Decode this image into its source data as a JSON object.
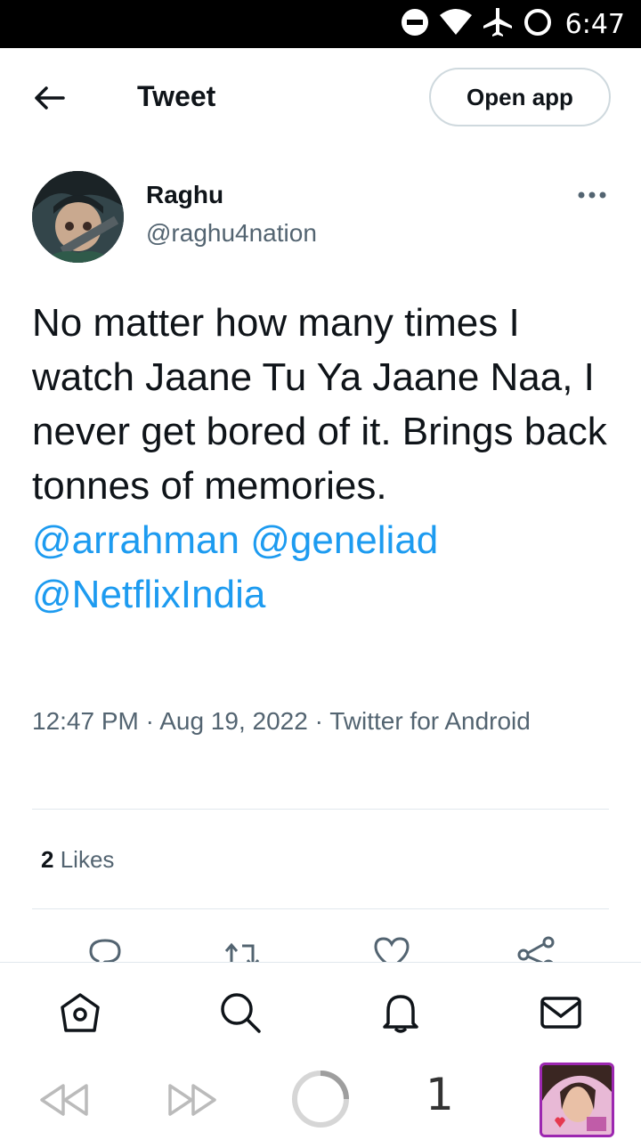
{
  "status_bar": {
    "time": "6:47",
    "icons": [
      "do-not-disturb-icon",
      "wifi-icon",
      "airplane-icon",
      "sync-circle-icon"
    ]
  },
  "header": {
    "title": "Tweet",
    "open_app_label": "Open app",
    "back_icon": "arrow-left-icon"
  },
  "author": {
    "name": "Raghu",
    "handle": "@raghu4nation",
    "more_icon": "more-horizontal-icon"
  },
  "tweet": {
    "text": "No matter how many times I watch Jaane Tu Ya Jaane Naa, I never get bored of it. Brings back tonnes of memories.",
    "mentions": [
      "@arrahman",
      "@geneliad",
      "@NetflixIndia"
    ],
    "time": "12:47 PM",
    "date": "Aug 19, 2022",
    "source": "Twitter for Android",
    "separator": "·"
  },
  "stats": {
    "likes_count": "2",
    "likes_label": "Likes"
  },
  "actions": [
    "reply-icon",
    "retweet-icon",
    "like-icon",
    "share-icon"
  ],
  "bottom_nav": [
    "home-icon",
    "search-icon",
    "notifications-icon",
    "messages-icon"
  ],
  "system_bar": {
    "count": "1",
    "icons": [
      "rewind-icon",
      "fast-forward-icon",
      "loading-circle-icon",
      "app-thumbnail"
    ]
  },
  "colors": {
    "link": "#1d9bf0",
    "text": "#0f1419",
    "secondary": "#536471",
    "border": "#cfd9de",
    "thumb_border": "#9c27b0"
  }
}
